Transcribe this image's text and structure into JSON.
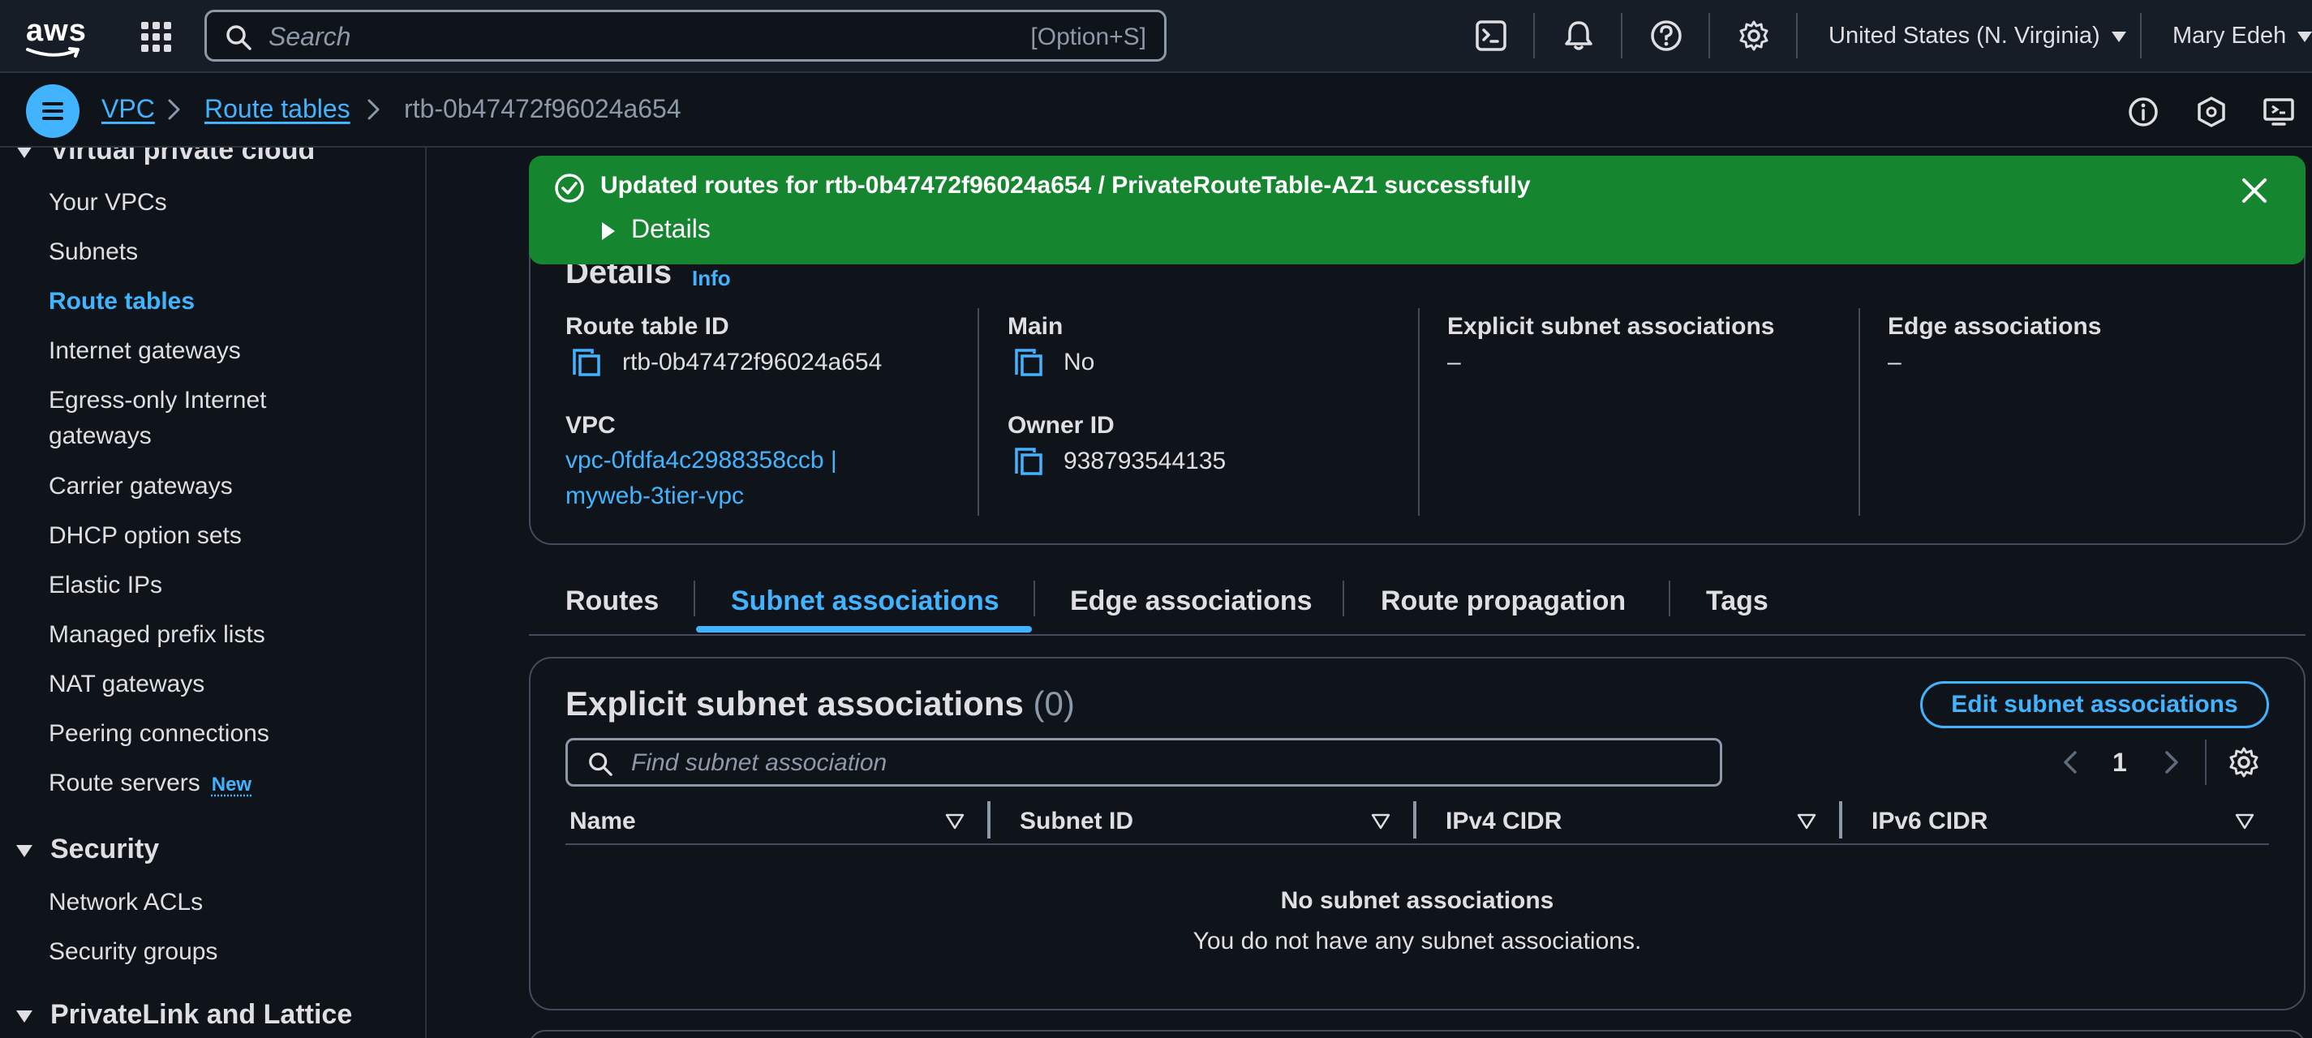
{
  "topnav": {
    "logo_text": "aws",
    "search": {
      "placeholder": "Search",
      "shortcut": "[Option+S]"
    },
    "region": "United States (N. Virginia)",
    "user": "Mary Edeh",
    "icons": [
      "cloudshell-icon",
      "notifications-bell-icon",
      "help-icon",
      "settings-gear-icon"
    ]
  },
  "breadcrumb": {
    "items": [
      {
        "label": "VPC"
      },
      {
        "label": "Route tables"
      },
      {
        "label": "rtb-0b47472f96024a654"
      }
    ],
    "right_icons": [
      "info-icon",
      "security-shield-icon",
      "screen-display-icon"
    ]
  },
  "sidebar": {
    "section_virtual_private_cloud": "Virtual private cloud",
    "items": [
      {
        "label": "Your VPCs"
      },
      {
        "label": "Subnets"
      },
      {
        "label": "Route tables"
      },
      {
        "label": "Internet gateways"
      },
      {
        "label": "Egress-only Internet gateways"
      },
      {
        "label": "Carrier gateways"
      },
      {
        "label": "DHCP option sets"
      },
      {
        "label": "Elastic IPs"
      },
      {
        "label": "Managed prefix lists"
      },
      {
        "label": "NAT gateways"
      },
      {
        "label": "Peering connections"
      },
      {
        "label": "Route servers",
        "badge": "New"
      }
    ],
    "section_security": "Security",
    "security_items": [
      {
        "label": "Network ACLs"
      },
      {
        "label": "Security groups"
      }
    ],
    "section_privatelink": "PrivateLink and Lattice"
  },
  "flash": {
    "message": "Updated routes for rtb-0b47472f96024a654 / PrivateRouteTable-AZ1 successfully",
    "details_label": "Details",
    "color": "#15862f"
  },
  "details": {
    "title": "Details",
    "info": "Info",
    "route_table_id_label": "Route table ID",
    "route_table_id": "rtb-0b47472f96024a654",
    "main_label": "Main",
    "main": "No",
    "explicit_label": "Explicit subnet associations",
    "explicit": "–",
    "edge_label": "Edge associations",
    "edge": "–",
    "vpc_label": "VPC",
    "vpc_line1": "vpc-0fdfa4c2988358ccb |",
    "vpc_line2": "myweb-3tier-vpc",
    "owner_label": "Owner ID",
    "owner": "938793544135"
  },
  "tabs": [
    {
      "label": "Routes"
    },
    {
      "label": "Subnet associations",
      "active": true
    },
    {
      "label": "Edge associations"
    },
    {
      "label": "Route propagation"
    },
    {
      "label": "Tags"
    }
  ],
  "subnet_assoc": {
    "title": "Explicit subnet associations",
    "count": "(0)",
    "edit_button": "Edit subnet associations",
    "filter_placeholder": "Find subnet association",
    "page": "1",
    "columns": [
      "Name",
      "Subnet ID",
      "IPv4 CIDR",
      "IPv6 CIDR"
    ],
    "empty_title": "No subnet associations",
    "empty_message": "You do not have any subnet associations."
  },
  "colors": {
    "accent": "#42b4ff",
    "background": "#0f141a",
    "nav_background": "#161d26",
    "success": "#15862f"
  }
}
